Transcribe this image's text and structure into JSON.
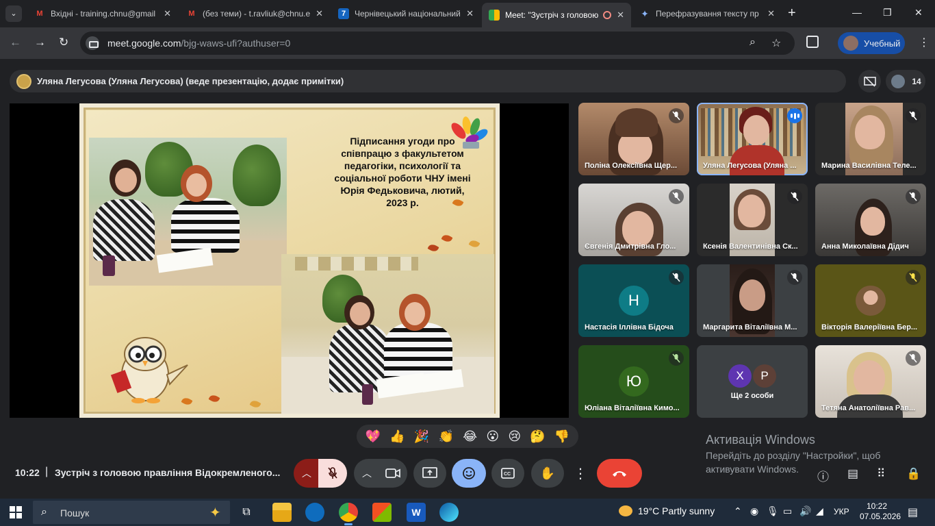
{
  "browser": {
    "tabs": [
      {
        "title": "Вхідні - training.chnu@gmail",
        "icon": "gmail-icon",
        "active": false
      },
      {
        "title": "(без теми) - t.ravliuk@chnu.edu",
        "icon": "gmail-icon",
        "active": false
      },
      {
        "title": "Чернівецький національний",
        "icon": "chnu-site-icon",
        "active": false
      },
      {
        "title": "Meet: \"Зустріч з головою",
        "icon": "meet-icon",
        "active": true
      },
      {
        "title": "Перефразування тексту пр",
        "icon": "gemini-icon",
        "active": false
      }
    ],
    "url_host": "meet.google.com",
    "url_path": "/bjg-waws-ufi?authuser=0",
    "profile_name": "Учебный"
  },
  "meet": {
    "presenter_text": "Уляна Легусова (Уляна Легусова) (веде презентацію, додає примітки)",
    "participant_count": "14",
    "slide": {
      "title": "Підписання угоди про співпрацю з факультетом педагогіки, психології та соціальної роботи ЧНУ імені Юрія Федьковича, лютий, 2023 р."
    },
    "tiles": [
      {
        "name": "Поліна Олексіївна Щер...",
        "state": "muted"
      },
      {
        "name": "Уляна Легусова (Уляна ...",
        "state": "speaking"
      },
      {
        "name": "Марина Василівна Теле...",
        "state": "muted"
      },
      {
        "name": "Євгенія Дмитрівна Гло...",
        "state": "muted"
      },
      {
        "name": "Ксенія Валентинівна Ск...",
        "state": "muted"
      },
      {
        "name": "Анна Миколаївна Дідич",
        "state": "muted"
      },
      {
        "name": "Настасія Іллівна Бідоча",
        "state": "muted",
        "initial": "Н",
        "color": "#0e7c86"
      },
      {
        "name": "Маргарита Віталіївна М...",
        "state": "muted"
      },
      {
        "name": "Вікторія Валеріївна Бер...",
        "state": "muted"
      },
      {
        "name": "Юліана Віталіївна Кимо...",
        "state": "muted",
        "initial": "Ю",
        "color": "#33691e"
      },
      {
        "name": "Тетяна Анатоліївна Рав...",
        "state": "muted"
      }
    ],
    "more_tile": {
      "label": "Ще 2 особи",
      "avatars": [
        "Х",
        "Р"
      ],
      "colors": [
        "#5e35b1",
        "#5d4037"
      ]
    },
    "reactions": [
      "💖",
      "👍",
      "🎉",
      "👏",
      "😂",
      "😮",
      "😢",
      "🤔",
      "👎"
    ],
    "clock": "10:22",
    "meeting_title": "Зустріч з головою правління Відокремленого..."
  },
  "windows_activation": {
    "title": "Активація Windows",
    "line1": "Перейдіть до розділу \"Настройки\", щоб",
    "line2": "активувати Windows."
  },
  "taskbar": {
    "search_placeholder": "Пошук",
    "weather": "19°C  Partly sunny",
    "language": "УКР",
    "time": "10:22",
    "date": "07.05.2026"
  },
  "colors": {
    "meet_bg": "#202124",
    "end_call": "#ea4335",
    "mic_off": "#f9dedc",
    "accent_blue": "#8ab4f8"
  }
}
